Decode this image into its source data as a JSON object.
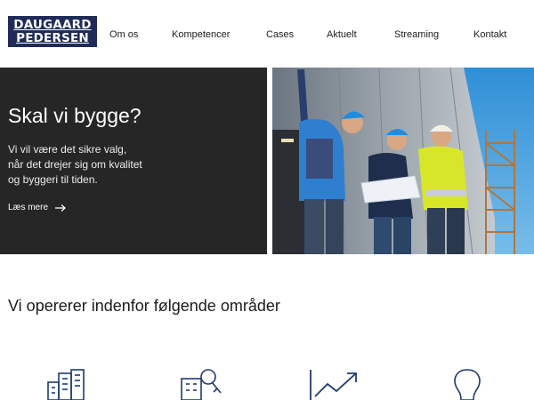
{
  "brand": {
    "line1": "DAUGAARD",
    "line2": "PEDERSEN",
    "color": "#1f2c59"
  },
  "nav": {
    "items": [
      {
        "label": "Om os"
      },
      {
        "label": "Kompetencer"
      },
      {
        "label": "Cases"
      },
      {
        "label": "Aktuelt"
      },
      {
        "label": "Streaming"
      },
      {
        "label": "Kontakt"
      }
    ]
  },
  "hero": {
    "title": "Skal vi bygge?",
    "text_lines": [
      "Vi vil være det sikre valg,",
      "når det drejer sig om kvalitet",
      "og byggeri til tiden."
    ],
    "cta_label": "Læs mere",
    "cta_icon": "arrow-right-icon",
    "photo": "three-construction-workers-icon",
    "panel_color": "#262626"
  },
  "areas": {
    "title": "Vi opererer indenfor følgende områder",
    "icons": [
      "buildings-icon",
      "building-key-icon",
      "growth-chart-icon",
      "lightbulb-icon"
    ],
    "icon_color": "#1f3a6e"
  }
}
